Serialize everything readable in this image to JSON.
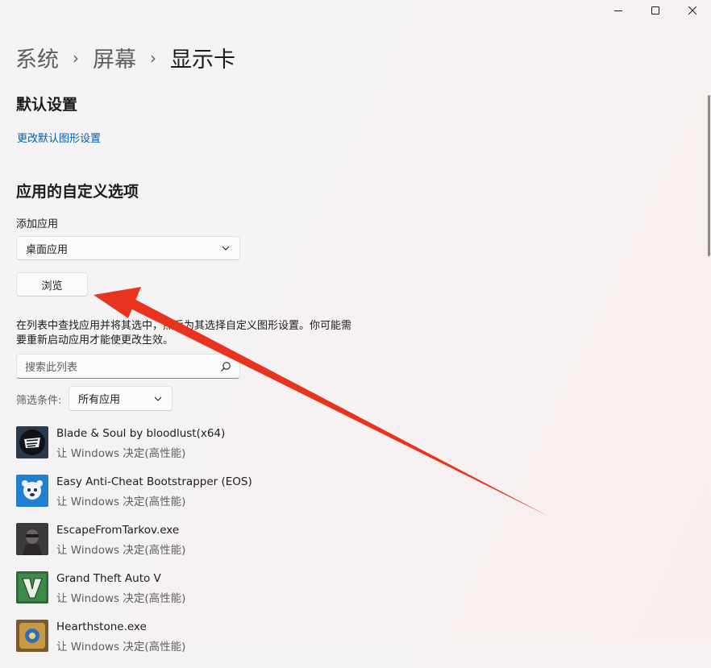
{
  "window": {
    "controls": {
      "minimize": "minimize-icon",
      "maximize": "maximize-icon",
      "close": "close-icon"
    }
  },
  "breadcrumb": {
    "items": [
      "系统",
      "屏幕",
      "显示卡"
    ],
    "separator": "›"
  },
  "default_settings": {
    "title": "默认设置",
    "link": "更改默认图形设置"
  },
  "custom_options": {
    "title": "应用的自定义选项",
    "add_app_label": "添加应用",
    "app_type_selected": "桌面应用",
    "browse_button": "浏览",
    "description_line1": "在列表中查找应用并将其选中，然后为其选择自定义图形设置。你可能需",
    "description_line2": "要重新启动应用才能使更改生效。",
    "search_placeholder": "搜索此列表",
    "filter_label": "筛选条件:",
    "filter_selected": "所有应用"
  },
  "apps": [
    {
      "name": "Blade & Soul by bloodlust(x64)",
      "pref": "让 Windows 决定(高性能)",
      "icon": "blade-and-soul-icon"
    },
    {
      "name": "Easy Anti-Cheat Bootstrapper (EOS)",
      "pref": "让 Windows 决定(高性能)",
      "icon": "easy-anti-cheat-icon"
    },
    {
      "name": "EscapeFromTarkov.exe",
      "pref": "让 Windows 决定(高性能)",
      "icon": "escape-from-tarkov-icon"
    },
    {
      "name": "Grand Theft Auto V",
      "pref": "让 Windows 决定(高性能)",
      "icon": "gta-v-icon"
    },
    {
      "name": "Hearthstone.exe",
      "pref": "让 Windows 决定(高性能)",
      "icon": "hearthstone-icon"
    }
  ],
  "annotation": {
    "type": "red-arrow",
    "color": "#e8341f",
    "points_to": "browse-button"
  },
  "colors": {
    "link": "#005fb8",
    "accent_arrow": "#e8341f"
  }
}
